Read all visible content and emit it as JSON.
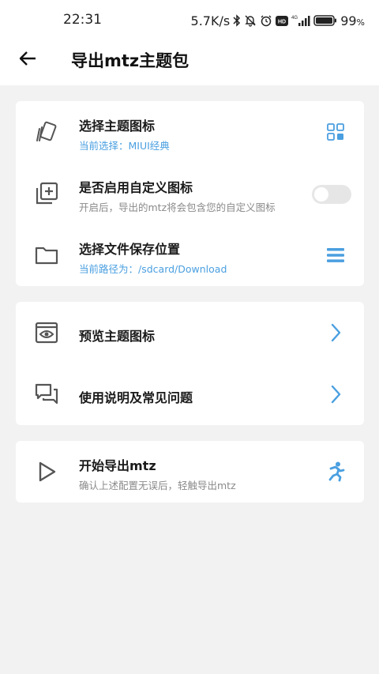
{
  "status_bar": {
    "time": "22:31",
    "net_speed": "5.7K/s",
    "battery_percent": "99",
    "battery_suffix": "%",
    "icons": [
      "bluetooth-icon",
      "mute-icon",
      "alarm-icon",
      "hd-icon",
      "signal-4g-icon",
      "battery-icon"
    ]
  },
  "header": {
    "back_icon": "arrow-left-icon",
    "title": "导出mtz主题包"
  },
  "settings": [
    {
      "icon": "cards-icon",
      "title": "选择主题图标",
      "subtitle": "当前选择：MIUI经典",
      "right": "grid-icon"
    },
    {
      "icon": "add-layers-icon",
      "title": "是否启用自定义图标",
      "subtitle": "开启后，导出的mtz将会包含您的自定义图标",
      "right": "toggle",
      "toggle_on": false
    },
    {
      "icon": "folder-icon",
      "title": "选择文件保存位置",
      "subtitle": "当前路径为：/sdcard/Download",
      "right": "menu-icon"
    }
  ],
  "nav_items": [
    {
      "icon": "preview-eye-icon",
      "title": "预览主题图标",
      "right": "chevron-right-icon"
    },
    {
      "icon": "chat-icon",
      "title": "使用说明及常见问题",
      "right": "chevron-right-icon"
    }
  ],
  "action": {
    "icon": "play-icon",
    "title": "开始导出mtz",
    "subtitle": "确认上述配置无误后，轻触导出mtz",
    "right": "runner-icon"
  },
  "colors": {
    "accent": "#4a9fe0",
    "background": "#f2f2f2",
    "card": "#ffffff",
    "icon_gray": "#555555"
  }
}
